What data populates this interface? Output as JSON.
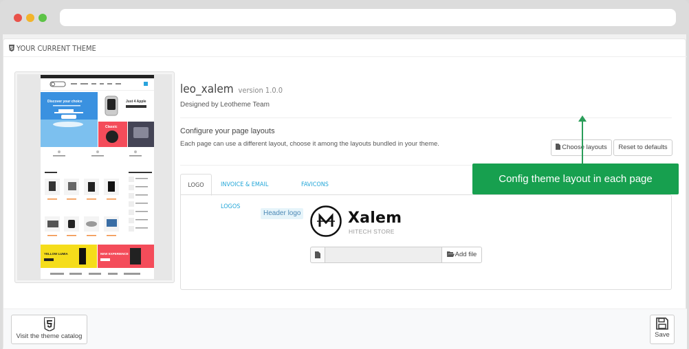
{
  "panel": {
    "title": "YOUR CURRENT THEME"
  },
  "theme": {
    "name": "leo_xalem",
    "version": "version 1.0.0",
    "designed_by": "Designed by Leotheme Team"
  },
  "layouts": {
    "title": "Configure your page layouts",
    "description": "Each page can use a different layout, choose it among the layouts bundled in your theme.",
    "choose_label": "Choose layouts",
    "reset_label": "Reset to defaults"
  },
  "tabs": [
    {
      "label": "LOGO",
      "active": true
    },
    {
      "label": "INVOICE & EMAIL LOGOS",
      "active": false
    },
    {
      "label": "FAVICONS",
      "active": false
    }
  ],
  "logo": {
    "label": "Header logo",
    "brand": "Xalem",
    "tagline": "HITECH STORE",
    "add_file_label": "Add file"
  },
  "footer": {
    "catalog_label": "Visit the theme catalog",
    "save_label": "Save"
  },
  "callout": {
    "text": "Config theme layout in each page",
    "color": "#17a04f"
  },
  "preview": {
    "promo1": "Discover your choice",
    "promo2": "Just 4 Apple",
    "promo3": "Classic",
    "promo4": "YELLOW LUMIA",
    "promo5": "NEW EXPERIENCE"
  },
  "icons": {
    "heading": "html5-icon",
    "choose": "file-icon",
    "file": "file-icon",
    "add_file": "folder-open-icon",
    "catalog": "html5-icon",
    "save": "floppy-disk-icon"
  }
}
